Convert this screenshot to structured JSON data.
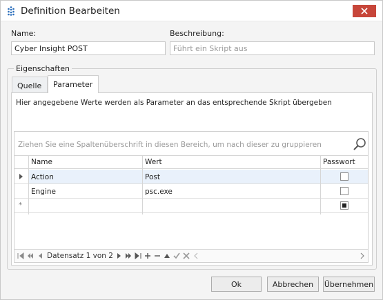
{
  "window": {
    "title": "Definition Bearbeiten"
  },
  "form": {
    "name_label": "Name:",
    "name_value": "Cyber Insight POST",
    "description_label": "Beschreibung:",
    "description_placeholder": "Führt ein Skript aus"
  },
  "properties": {
    "group_label": "Eigenschaften",
    "tabs": [
      {
        "label": "Quelle",
        "active": false
      },
      {
        "label": "Parameter",
        "active": true
      }
    ],
    "description": "Hier angegebene Werte werden als Parameter an das entsprechende Skript übergeben"
  },
  "grid": {
    "group_hint": "Ziehen Sie eine Spaltenüberschrift in diesen Bereich, um nach dieser zu gruppieren",
    "columns": [
      "Name",
      "Wert",
      "Passwort"
    ],
    "rows": [
      {
        "name": "Action",
        "value": "Post",
        "password": false,
        "selected": true
      },
      {
        "name": "Engine",
        "value": "psc.exe",
        "password": false,
        "selected": false
      }
    ],
    "new_row": {
      "indicator": "*",
      "password": true
    },
    "navigator": {
      "record_text": "Datensatz 1 von 2"
    }
  },
  "buttons": {
    "ok": "Ok",
    "cancel": "Abbrechen",
    "apply": "Übernehmen"
  },
  "colors": {
    "close_button": "#c7463a",
    "selected_row": "#e9f1fb",
    "app_icon": "#2a6ebb"
  }
}
